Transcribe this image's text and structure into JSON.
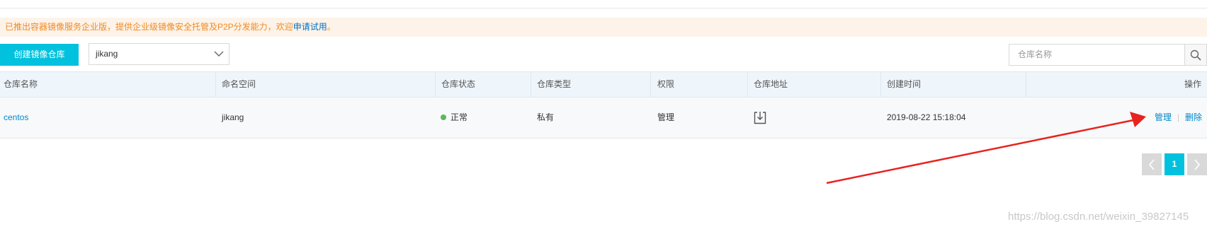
{
  "notice": {
    "text": "已推出容器镜像服务企业版，提供企业级镜像安全托管及P2P分发能力，欢迎",
    "link": "申请试用",
    "suffix": "。"
  },
  "toolbar": {
    "create_label": "创建镜像仓库",
    "namespace_value": "jikang",
    "search_placeholder": "仓库名称"
  },
  "table": {
    "headers": [
      "仓库名称",
      "命名空间",
      "仓库状态",
      "仓库类型",
      "权限",
      "仓库地址",
      "创建时间",
      "操作"
    ],
    "rows": [
      {
        "name": "centos",
        "namespace": "jikang",
        "status": "正常",
        "type": "私有",
        "permission": "管理",
        "created": "2019-08-22 15:18:04",
        "actions": [
          "管理",
          "删除"
        ]
      }
    ]
  },
  "pagination": {
    "current": "1"
  },
  "watermark": "https://blog.csdn.net/weixin_39827145",
  "colors": {
    "accent": "#00c1de",
    "link": "#0088cc",
    "notice_text": "#f08a24",
    "annotation_arrow": "#e8231f"
  },
  "icons": {
    "address": "download-icon",
    "search": "search-icon"
  }
}
